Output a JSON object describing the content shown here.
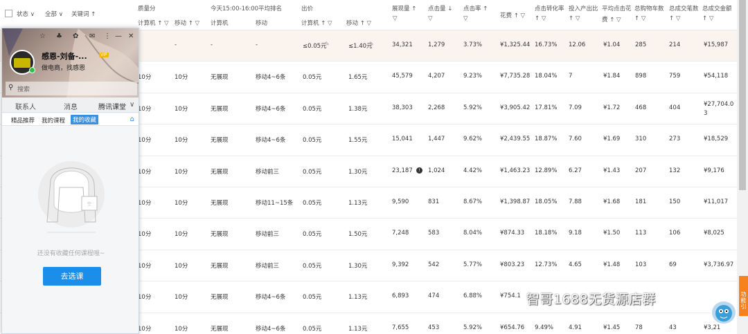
{
  "toolbar": {
    "status_label": "状态 ∨",
    "all_label": "全部 ∨",
    "keyword_label": "关键词 ↑"
  },
  "header_groups": {
    "quality": "质量分",
    "rank": "今天15:00-16:00平均排名",
    "bid": "出价",
    "impressions": "展现量 ↑",
    "clicks": "点击量 ↓",
    "ctr": "点击率 ↑",
    "cost": "花费 ↑ ▽",
    "cvr": "点击转化率",
    "roi": "投入产出比",
    "cpc": "平均点击花",
    "cpc_2": "费 ↑ ▽",
    "carts": "总购物车数",
    "orders": "总成交笔数",
    "gmv": "总成交金额"
  },
  "sub_headers": {
    "pc": "计算机 ↑ ▽",
    "mobile": "移动 ↑ ▽",
    "rank_pc": "计算机",
    "rank_mobile": "移动",
    "bid_pc": "计算机 ↑ ▽",
    "bid_mobile": "移动 ↑ ▽",
    "filter": "▽",
    "sort_filter": "↑ ▽"
  },
  "rows": [
    {
      "q_pc": "",
      "q_mobile": "-",
      "rank_pc": "-",
      "rank_mobile": "-",
      "bid_pc": "≤0.05元",
      "bid_mobile": "≤1.40元",
      "impr": "34,321",
      "clicks": "1,279",
      "ctr": "3.73%",
      "cost": "¥1,325.44",
      "cvr": "16.73%",
      "roi": "12.06",
      "cpc": "¥1.04",
      "carts": "285",
      "orders": "214",
      "gmv": "¥15,987"
    },
    {
      "q_pc": "10分",
      "q_mobile": "10分",
      "rank_pc": "无展现",
      "rank_mobile": "移动4~6条",
      "bid_pc": "0.05元",
      "bid_mobile": "1.65元",
      "impr": "45,579",
      "clicks": "4,207",
      "ctr": "9.23%",
      "cost": "¥7,735.28",
      "cvr": "18.04%",
      "roi": "7",
      "cpc": "¥1.84",
      "carts": "898",
      "orders": "759",
      "gmv": "¥54,118"
    },
    {
      "q_pc": "10分",
      "q_mobile": "10分",
      "rank_pc": "无展现",
      "rank_mobile": "移动4~6条",
      "bid_pc": "0.05元",
      "bid_mobile": "1.38元",
      "impr": "38,303",
      "clicks": "2,268",
      "ctr": "5.92%",
      "cost": "¥3,905.42",
      "cvr": "17.81%",
      "roi": "7.09",
      "cpc": "¥1.72",
      "carts": "468",
      "orders": "404",
      "gmv": "¥27,704.03"
    },
    {
      "q_pc": "10分",
      "q_mobile": "10分",
      "rank_pc": "无展现",
      "rank_mobile": "移动4~6条",
      "bid_pc": "0.05元",
      "bid_mobile": "1.55元",
      "impr": "15,041",
      "clicks": "1,447",
      "ctr": "9.62%",
      "cost": "¥2,439.55",
      "cvr": "18.87%",
      "roi": "7.60",
      "cpc": "¥1.69",
      "carts": "310",
      "orders": "273",
      "gmv": "¥18,529"
    },
    {
      "q_pc": "10分",
      "q_mobile": "10分",
      "rank_pc": "无展现",
      "rank_mobile": "移动前三",
      "bid_pc": "0.05元",
      "bid_mobile": "1.30元",
      "impr": "23,187",
      "clicks": "1,024",
      "ctr": "4.42%",
      "cost": "¥1,463.23",
      "cvr": "12.89%",
      "roi": "6.27",
      "cpc": "¥1.43",
      "carts": "207",
      "orders": "132",
      "gmv": "¥9,176"
    },
    {
      "q_pc": "10分",
      "q_mobile": "10分",
      "rank_pc": "无展现",
      "rank_mobile": "移动11~15条",
      "bid_pc": "0.05元",
      "bid_mobile": "1.13元",
      "impr": "9,590",
      "clicks": "831",
      "ctr": "8.67%",
      "cost": "¥1,398.87",
      "cvr": "18.05%",
      "roi": "7.88",
      "cpc": "¥1.68",
      "carts": "181",
      "orders": "150",
      "gmv": "¥11,017"
    },
    {
      "q_pc": "10分",
      "q_mobile": "10分",
      "rank_pc": "无展现",
      "rank_mobile": "移动前三",
      "bid_pc": "0.05元",
      "bid_mobile": "1.50元",
      "impr": "7,248",
      "clicks": "583",
      "ctr": "8.04%",
      "cost": "¥874.33",
      "cvr": "18.18%",
      "roi": "9.18",
      "cpc": "¥1.50",
      "carts": "113",
      "orders": "106",
      "gmv": "¥8,025"
    },
    {
      "q_pc": "10分",
      "q_mobile": "10分",
      "rank_pc": "无展现",
      "rank_mobile": "移动前三",
      "bid_pc": "0.05元",
      "bid_mobile": "1.30元",
      "impr": "9,392",
      "clicks": "542",
      "ctr": "5.77%",
      "cost": "¥803.23",
      "cvr": "12.73%",
      "roi": "4.65",
      "cpc": "¥1.48",
      "carts": "103",
      "orders": "69",
      "gmv": "¥3,736.97"
    },
    {
      "q_pc": "10分",
      "q_mobile": "10分",
      "rank_pc": "无展现",
      "rank_mobile": "移动4~6条",
      "bid_pc": "0.05元",
      "bid_mobile": "1.13元",
      "impr": "6,893",
      "clicks": "474",
      "ctr": "6.88%",
      "cost": "¥754.1",
      "cvr": "",
      "roi": "",
      "cpc": "",
      "carts": "",
      "orders": "",
      "gmv": ""
    },
    {
      "q_pc": "10分",
      "q_mobile": "10分",
      "rank_pc": "无展现",
      "rank_mobile": "移动4~6条",
      "bid_pc": "0.05元",
      "bid_mobile": "1.13元",
      "impr": "7,655",
      "clicks": "453",
      "ctr": "5.92%",
      "cost": "¥654.76",
      "cvr": "9.49%",
      "roi": "4.91",
      "cpc": "¥1.45",
      "carts": "78",
      "orders": "43",
      "gmv": "¥3,21"
    }
  ],
  "qq": {
    "name": "感恩-刘备-...",
    "vip": "VIP",
    "signature": "做电商，找感恩",
    "search_placeholder": "搜索",
    "tabs": [
      "联系人",
      "消息",
      "腾讯课堂"
    ],
    "sub_tabs": [
      "精品推荐",
      "我的课程",
      "我的收藏"
    ],
    "empty_text": "还没有收藏任何课程哦~",
    "choose_button": "去选课"
  },
  "watermark": "智哥1688无货源店群",
  "side_tab": "功能引"
}
